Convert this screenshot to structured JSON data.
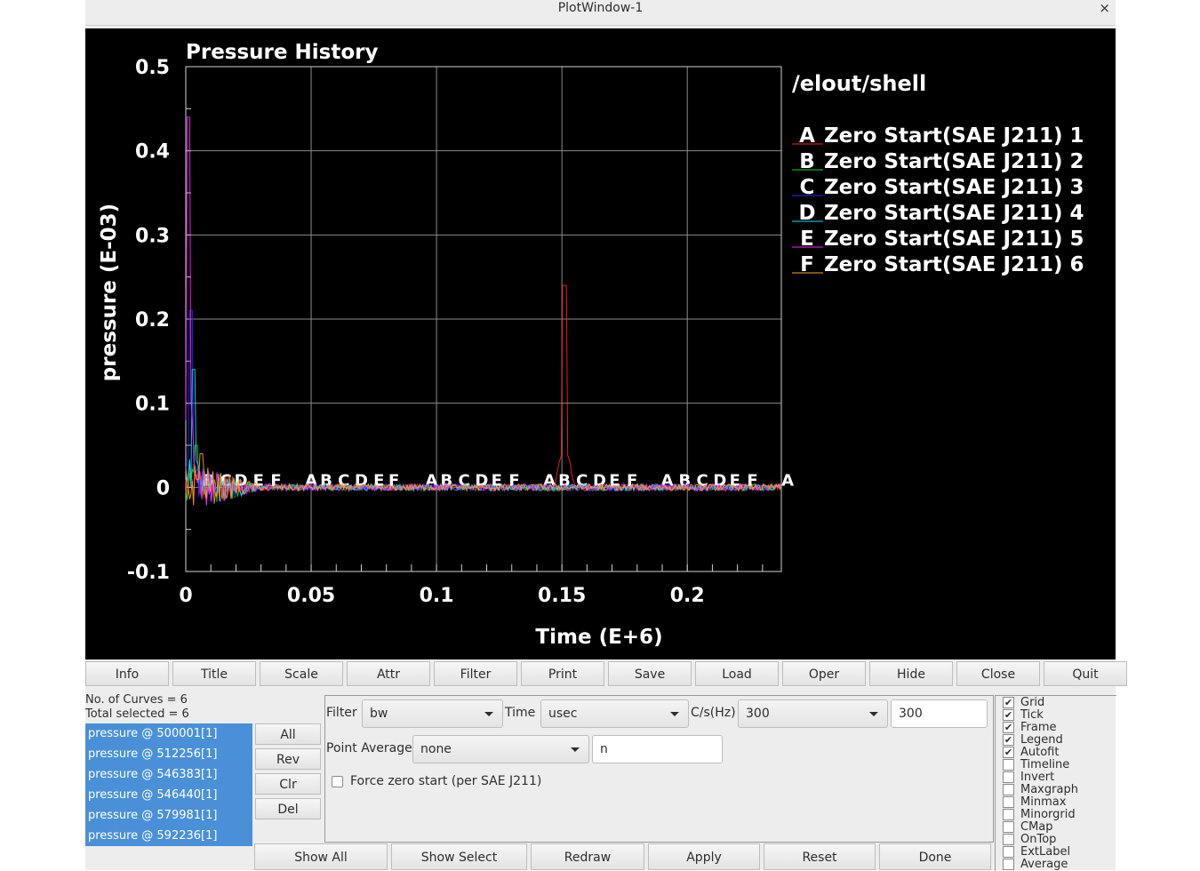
{
  "window": {
    "title": "PlotWindow-1",
    "close_label": "×"
  },
  "chart_data": {
    "type": "line",
    "title": "Pressure History",
    "xlabel": "Time (E+6)",
    "ylabel": "pressure (E-03)",
    "xlim": [
      0,
      0.2375
    ],
    "ylim": [
      -0.1,
      0.5
    ],
    "xticks": [
      0,
      0.05,
      0.1,
      0.15,
      0.2
    ],
    "xtick_labels": [
      "0",
      "0.05",
      "0.1",
      "0.15",
      "0.2"
    ],
    "yticks": [
      -0.1,
      0,
      0.1,
      0.2,
      0.3,
      0.4,
      0.5
    ],
    "ytick_labels": [
      "-0.1",
      "0",
      "0.1",
      "0.2",
      "0.3",
      "0.4",
      "0.5"
    ],
    "grid": true,
    "legend_position": "right",
    "legend_title": "/elout/shell",
    "series": [
      {
        "marker": "A",
        "name": "Zero Start(SAE J211) 1",
        "color": "#ff2020",
        "peak": {
          "x": 0.151,
          "y": 0.24
        },
        "marker_x": [
          0.05,
          0.098,
          0.145,
          0.192,
          0.24
        ]
      },
      {
        "marker": "B",
        "name": "Zero Start(SAE J211) 2",
        "color": "#20d020",
        "peak": {
          "x": 0.004,
          "y": 0.05
        },
        "marker_x": [
          0.009,
          0.056,
          0.104,
          0.151,
          0.199
        ]
      },
      {
        "marker": "C",
        "name": "Zero Start(SAE J211) 3",
        "color": "#2a2aff",
        "peak": {
          "x": 0.002,
          "y": 0.21
        },
        "marker_x": [
          0.016,
          0.063,
          0.111,
          0.158,
          0.206
        ]
      },
      {
        "marker": "D",
        "name": "Zero Start(SAE J211) 4",
        "color": "#00e0ff",
        "peak": {
          "x": 0.003,
          "y": 0.14
        },
        "marker_x": [
          0.022,
          0.07,
          0.118,
          0.165,
          0.213
        ]
      },
      {
        "marker": "E",
        "name": "Zero Start(SAE J211) 5",
        "color": "#ff20ff",
        "peak": {
          "x": 0.001,
          "y": 0.44
        },
        "marker_x": [
          0.029,
          0.077,
          0.124,
          0.171,
          0.219
        ]
      },
      {
        "marker": "F",
        "name": "Zero Start(SAE J211) 6",
        "color": "#ffa020",
        "peak": {
          "x": 0.006,
          "y": 0.04
        },
        "marker_x": [
          0.036,
          0.083,
          0.131,
          0.178,
          0.226
        ]
      }
    ]
  },
  "toolbar": [
    "Info",
    "Title",
    "Scale",
    "Attr",
    "Filter",
    "Print",
    "Save",
    "Load",
    "Oper",
    "Hide",
    "Close",
    "Quit"
  ],
  "info": {
    "curves": "No. of Curves = 6",
    "selected": "Total selected = 6"
  },
  "curves": [
    "pressure @ 500001[1]",
    "pressure @ 512256[1]",
    "pressure @ 546383[1]",
    "pressure @ 546440[1]",
    "pressure @ 579981[1]",
    "pressure @ 592236[1]"
  ],
  "side_buttons": [
    "All",
    "Rev",
    "Clr",
    "Del"
  ],
  "filter": {
    "filter_label": "Filter",
    "filter_value": "bw",
    "time_label": "Time",
    "time_value": "usec",
    "cs_label": "C/s(Hz)",
    "cs_value": "300",
    "cs_input": "300",
    "pa_label": "Point Average",
    "pa_value": "none",
    "pa_input": "n",
    "force_label": "Force zero start (per SAE J211)"
  },
  "bottom_buttons": [
    "Show All",
    "Show Select",
    "Redraw",
    "Apply",
    "Reset",
    "Done"
  ],
  "options": [
    {
      "label": "Grid",
      "checked": true
    },
    {
      "label": "Tick",
      "checked": true
    },
    {
      "label": "Frame",
      "checked": true
    },
    {
      "label": "Legend",
      "checked": true
    },
    {
      "label": "Autofit",
      "checked": true
    },
    {
      "label": "Timeline",
      "checked": false
    },
    {
      "label": "Invert",
      "checked": false
    },
    {
      "label": "Maxgraph",
      "checked": false
    },
    {
      "label": "Minmax",
      "checked": false
    },
    {
      "label": "Minorgrid",
      "checked": false
    },
    {
      "label": "CMap",
      "checked": false
    },
    {
      "label": "OnTop",
      "checked": false
    },
    {
      "label": "ExtLabel",
      "checked": false
    },
    {
      "label": "Average",
      "checked": false
    }
  ]
}
